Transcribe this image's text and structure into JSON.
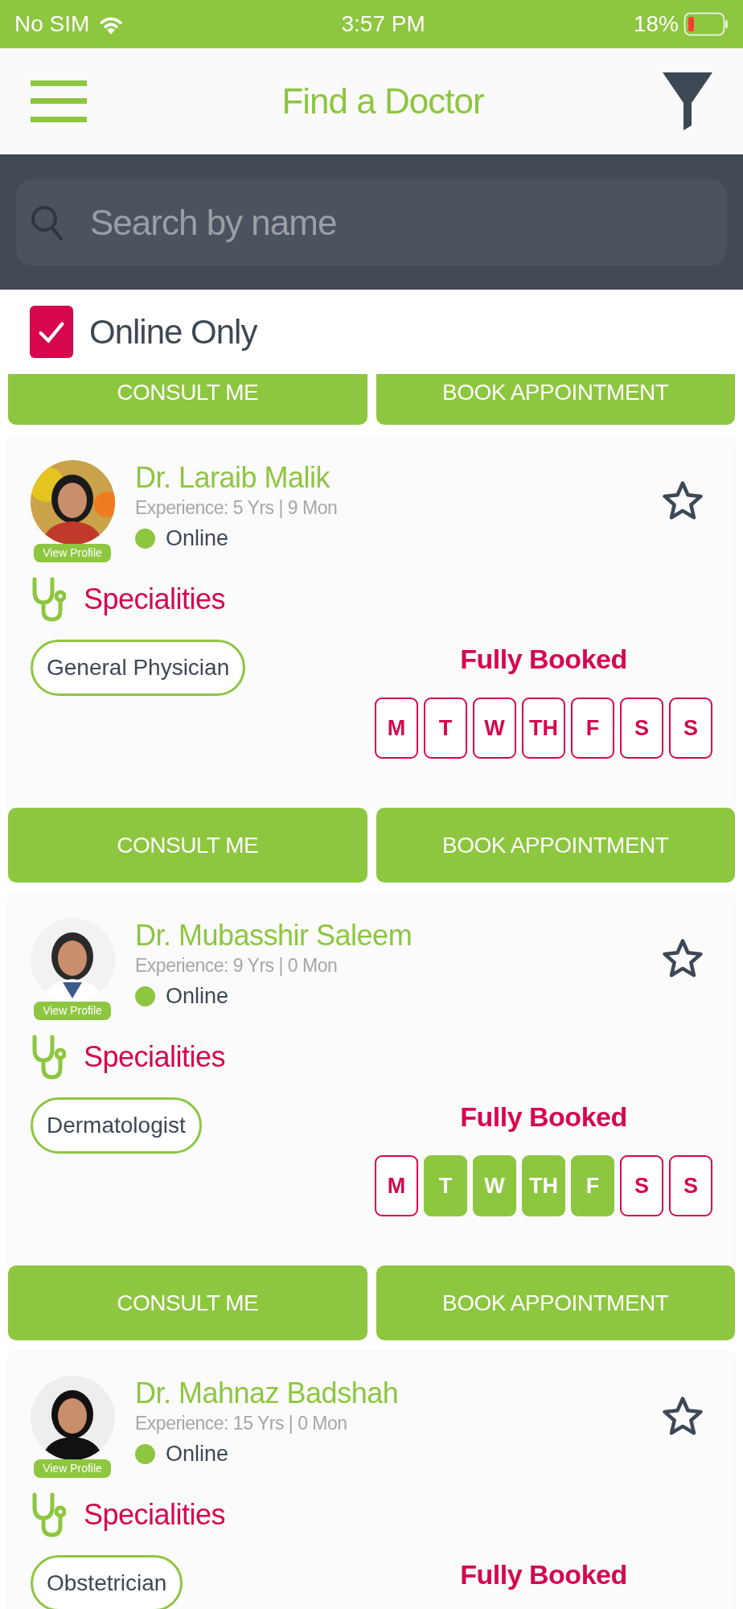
{
  "status_bar": {
    "carrier": "No SIM",
    "time": "3:57 PM",
    "battery": "18%"
  },
  "header": {
    "title": "Find a Doctor"
  },
  "search": {
    "placeholder": "Search by name"
  },
  "online_filter": {
    "label": "Online Only",
    "checked": true
  },
  "partial_card": {
    "buttons": [
      "CONSULT ME",
      "BOOK APPOINTMENT"
    ]
  },
  "doctors": [
    {
      "name": "Dr. Laraib Malik",
      "experience": "Experience: 5 Yrs | 9 Mon",
      "view_profile": "View Profile",
      "status": "Online",
      "favorite": false,
      "specialities_label": "Specialities",
      "specialities": [
        "General Physician"
      ],
      "availability": "Fully Booked",
      "days": [
        {
          "label": "M",
          "available": false
        },
        {
          "label": "T",
          "available": false
        },
        {
          "label": "W",
          "available": false
        },
        {
          "label": "TH",
          "available": false
        },
        {
          "label": "F",
          "available": false
        },
        {
          "label": "S",
          "available": false
        },
        {
          "label": "S",
          "available": false
        }
      ],
      "buttons": [
        "CONSULT ME",
        "BOOK APPOINTMENT"
      ]
    },
    {
      "name": "Dr. Mubasshir Saleem",
      "experience": "Experience: 9 Yrs | 0 Mon",
      "view_profile": "View Profile",
      "status": "Online",
      "favorite": false,
      "specialities_label": "Specialities",
      "specialities": [
        "Dermatologist"
      ],
      "availability": "Fully Booked",
      "days": [
        {
          "label": "M",
          "available": false
        },
        {
          "label": "T",
          "available": true
        },
        {
          "label": "W",
          "available": true
        },
        {
          "label": "TH",
          "available": true
        },
        {
          "label": "F",
          "available": true
        },
        {
          "label": "S",
          "available": false
        },
        {
          "label": "S",
          "available": false
        }
      ],
      "buttons": [
        "CONSULT ME",
        "BOOK APPOINTMENT"
      ]
    },
    {
      "name": "Dr. Mahnaz Badshah",
      "experience": "Experience: 15 Yrs | 0 Mon",
      "view_profile": "View Profile",
      "status": "Online",
      "favorite": false,
      "specialities_label": "Specialities",
      "specialities": [
        "Obstetrician"
      ],
      "availability": "Fully Booked"
    }
  ]
}
